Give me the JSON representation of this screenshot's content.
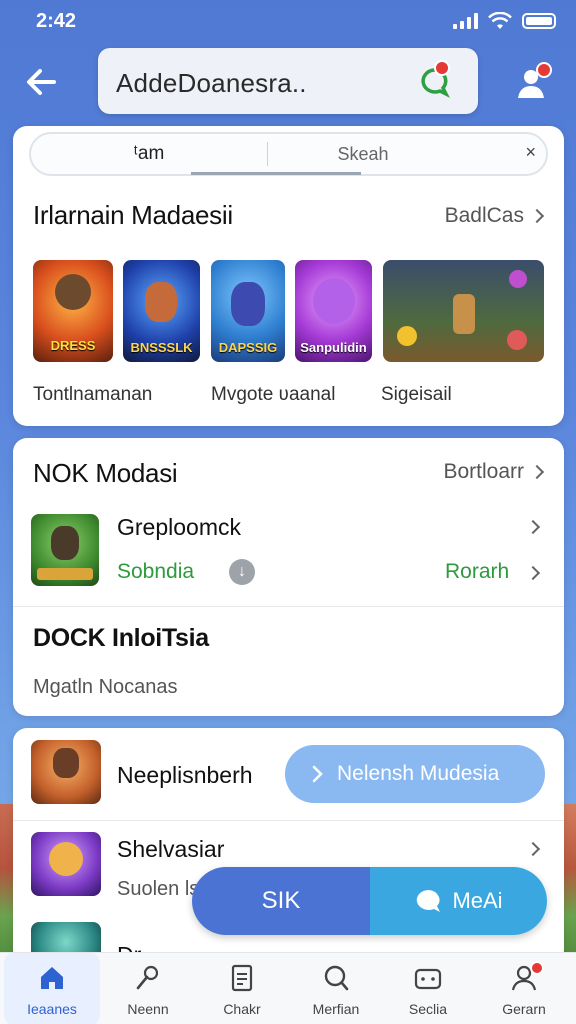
{
  "status_bar": {
    "time": "2:42"
  },
  "header": {
    "search_text": "AddeDoanesra..",
    "chat_icon": "chat-bubble-icon",
    "profile_icon": "user-icon"
  },
  "tabs": {
    "active": "ᵗam",
    "second": "Skeah",
    "close": "×"
  },
  "section1": {
    "title": "Irlarnain Madaesii",
    "see_more": "BadlCas",
    "thumbs": [
      {
        "caption": "DRESS"
      },
      {
        "caption": "BNSSSLK"
      },
      {
        "caption": "DAPSSIG"
      },
      {
        "caption": "Sanpulidin"
      },
      {
        "caption": ""
      }
    ],
    "captions": [
      "Tontlnamanan",
      "Mvgote ʋaanal",
      "Sigeisail"
    ]
  },
  "section2": {
    "title": "NOK Modasi",
    "see_more": "Bortloarr",
    "item": {
      "title": "Greploomck",
      "sub": "Sobndia",
      "right": "Rorarh"
    },
    "title2": "DOCK InloiTsia",
    "sub2": "Mgatln Nocanas"
  },
  "section3": {
    "items": [
      {
        "title": "Neeplisnberh"
      },
      {
        "title": "Shelvasiar",
        "sub": "Suolen ls"
      },
      {
        "title": "Dr..."
      }
    ],
    "pill_button": "Nelensh Mudesia"
  },
  "split_button": {
    "left": "SIK",
    "right": "MeAi"
  },
  "bottom_nav": [
    {
      "label": "Ieaanes",
      "icon": "home-icon"
    },
    {
      "label": "Neenn",
      "icon": "microphone-icon"
    },
    {
      "label": "Chakr",
      "icon": "clipboard-icon"
    },
    {
      "label": "Merfian",
      "icon": "search-icon"
    },
    {
      "label": "Seclia",
      "icon": "game-controller-icon"
    },
    {
      "label": "Gerarn",
      "icon": "user-icon"
    }
  ],
  "colors": {
    "accent": "#2f62d1",
    "green": "#2e9a3e",
    "background": "#5b86dd"
  }
}
